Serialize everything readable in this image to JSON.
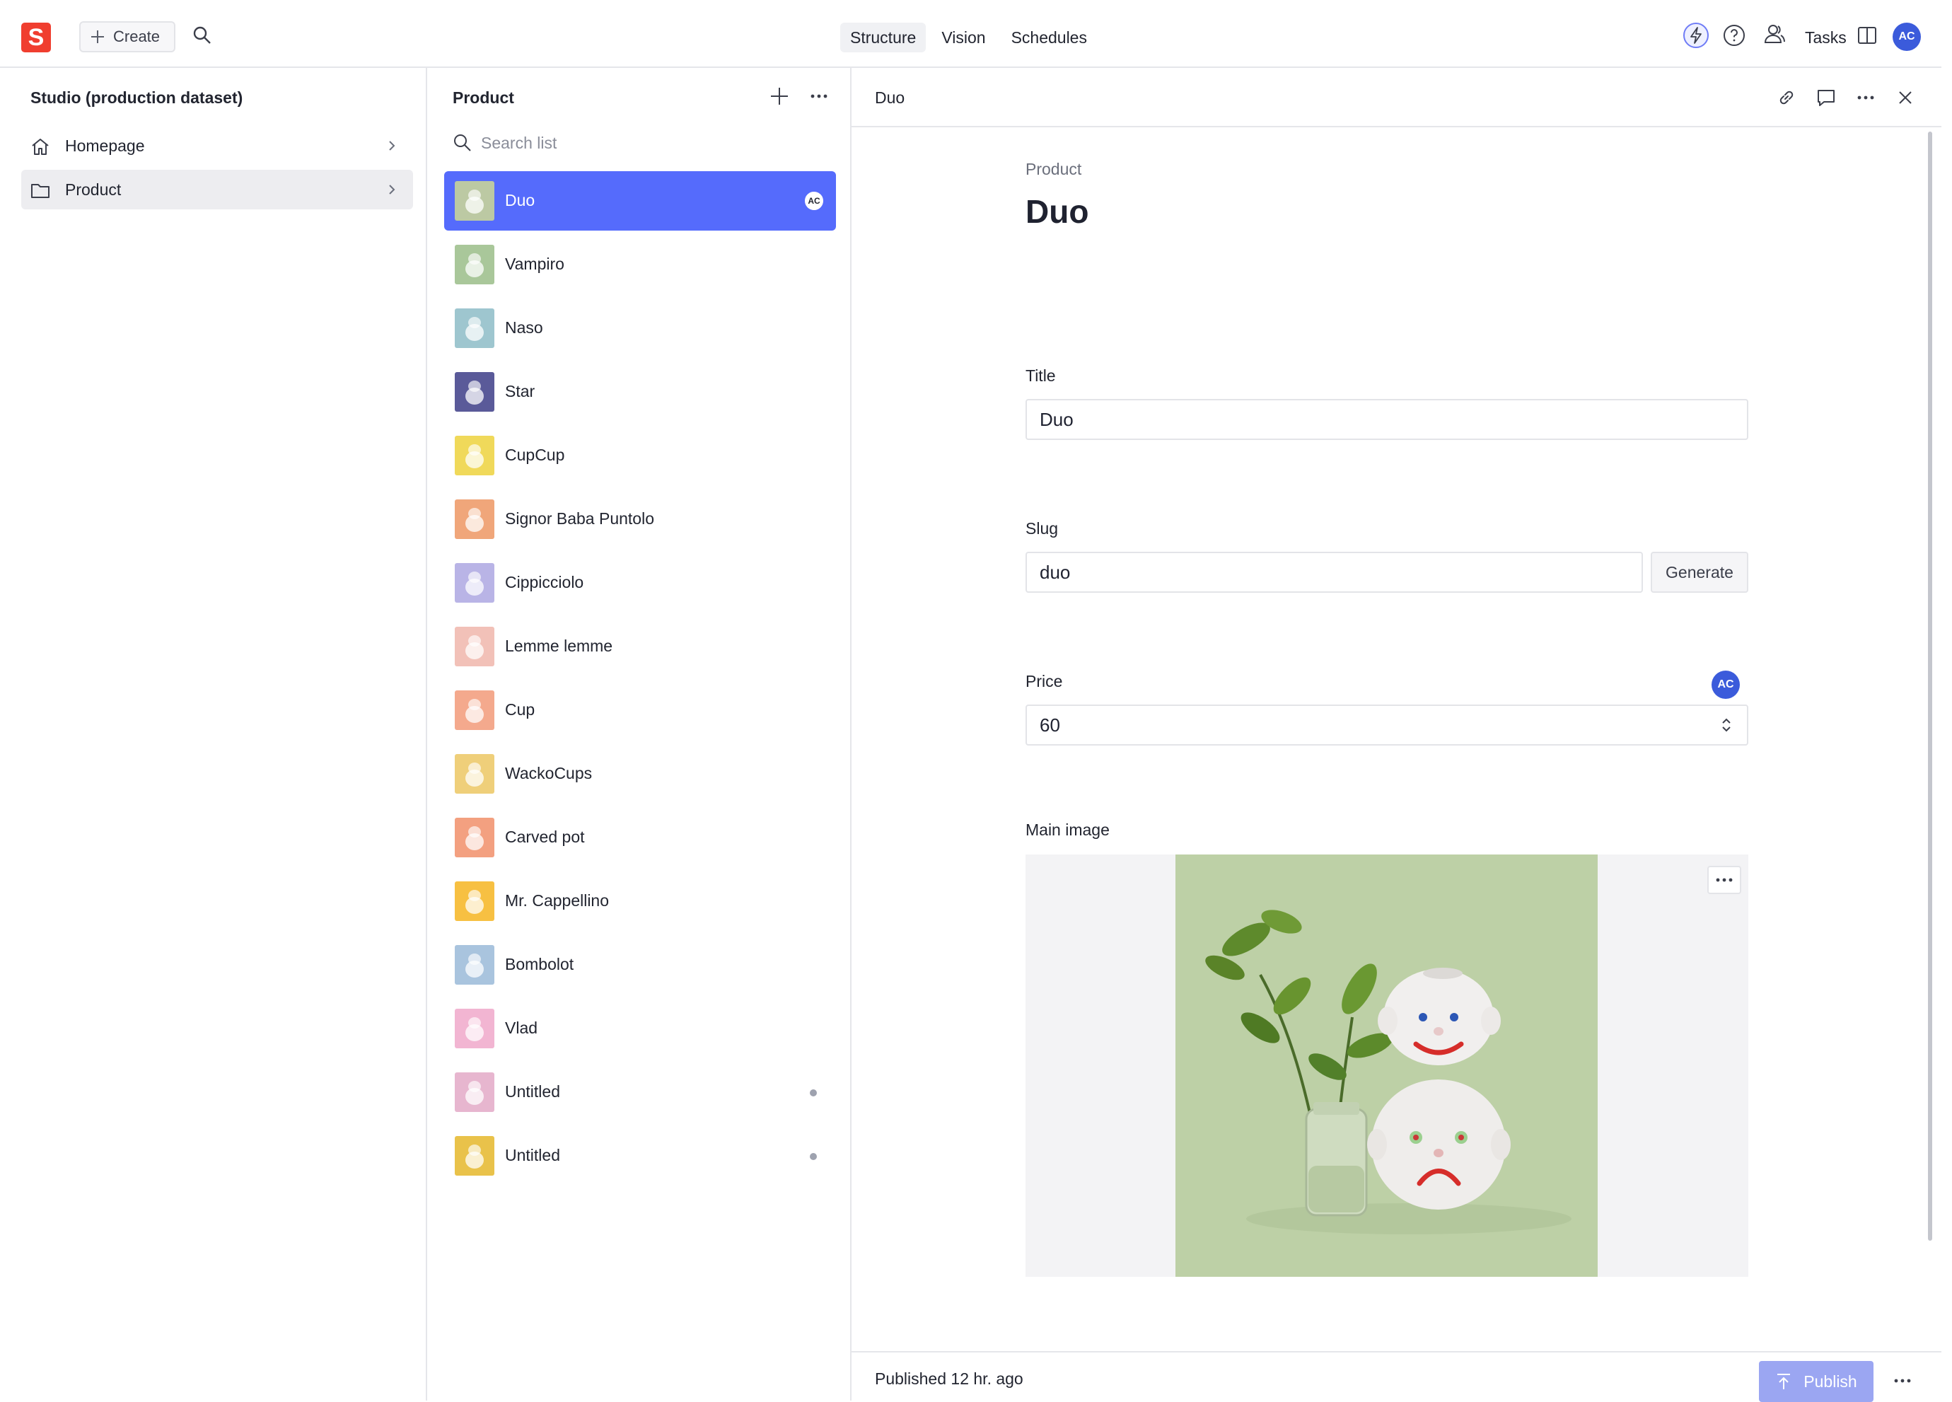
{
  "topbar": {
    "logo_letter": "S",
    "create_label": "Create",
    "tabs": [
      {
        "label": "Structure",
        "active": true
      },
      {
        "label": "Vision",
        "active": false
      },
      {
        "label": "Schedules",
        "active": false
      }
    ],
    "tasks_label": "Tasks",
    "user_initials": "AC",
    "accent_color": "#556bfc",
    "brand_color": "#f03e2f"
  },
  "pane1": {
    "title": "Studio (production dataset)",
    "items": [
      {
        "label": "Homepage",
        "icon": "home-icon",
        "selected": false
      },
      {
        "label": "Product",
        "icon": "folder-icon",
        "selected": true
      }
    ]
  },
  "pane2": {
    "title": "Product",
    "search_placeholder": "Search list",
    "items": [
      {
        "label": "Duo",
        "thumb": "#bcc9a3",
        "selected": true,
        "badge": "AC"
      },
      {
        "label": "Vampiro",
        "thumb": "#a9c79a"
      },
      {
        "label": "Naso",
        "thumb": "#9ec6cf"
      },
      {
        "label": "Star",
        "thumb": "#5a5a99"
      },
      {
        "label": "CupCup",
        "thumb": "#f0d95a"
      },
      {
        "label": "Signor Baba Puntolo",
        "thumb": "#f0a67a"
      },
      {
        "label": "Cippicciolo",
        "thumb": "#b9b4e6"
      },
      {
        "label": "Lemme lemme",
        "thumb": "#f2c1b8"
      },
      {
        "label": "Cup",
        "thumb": "#f4a98d"
      },
      {
        "label": "WackoCups",
        "thumb": "#efcf7a"
      },
      {
        "label": "Carved pot",
        "thumb": "#f3a080"
      },
      {
        "label": "Mr. Cappellino",
        "thumb": "#f7c042"
      },
      {
        "label": "Bombolot",
        "thumb": "#a9c4de"
      },
      {
        "label": "Vlad",
        "thumb": "#f2b5d2"
      },
      {
        "label": "Untitled",
        "thumb": "#e7b6cf",
        "draft": true
      },
      {
        "label": "Untitled",
        "thumb": "#e9c24a",
        "draft": true
      }
    ]
  },
  "document": {
    "pane_title": "Duo",
    "type_label": "Product",
    "title": "Duo",
    "fields": {
      "title": {
        "label": "Title",
        "value": "Duo"
      },
      "slug": {
        "label": "Slug",
        "value": "duo",
        "button": "Generate"
      },
      "price": {
        "label": "Price",
        "value": "60",
        "presence": "AC"
      },
      "main_image": {
        "label": "Main image",
        "background": "#bdd0a6"
      }
    },
    "status": "Published 12 hr. ago",
    "publish_label": "Publish"
  }
}
